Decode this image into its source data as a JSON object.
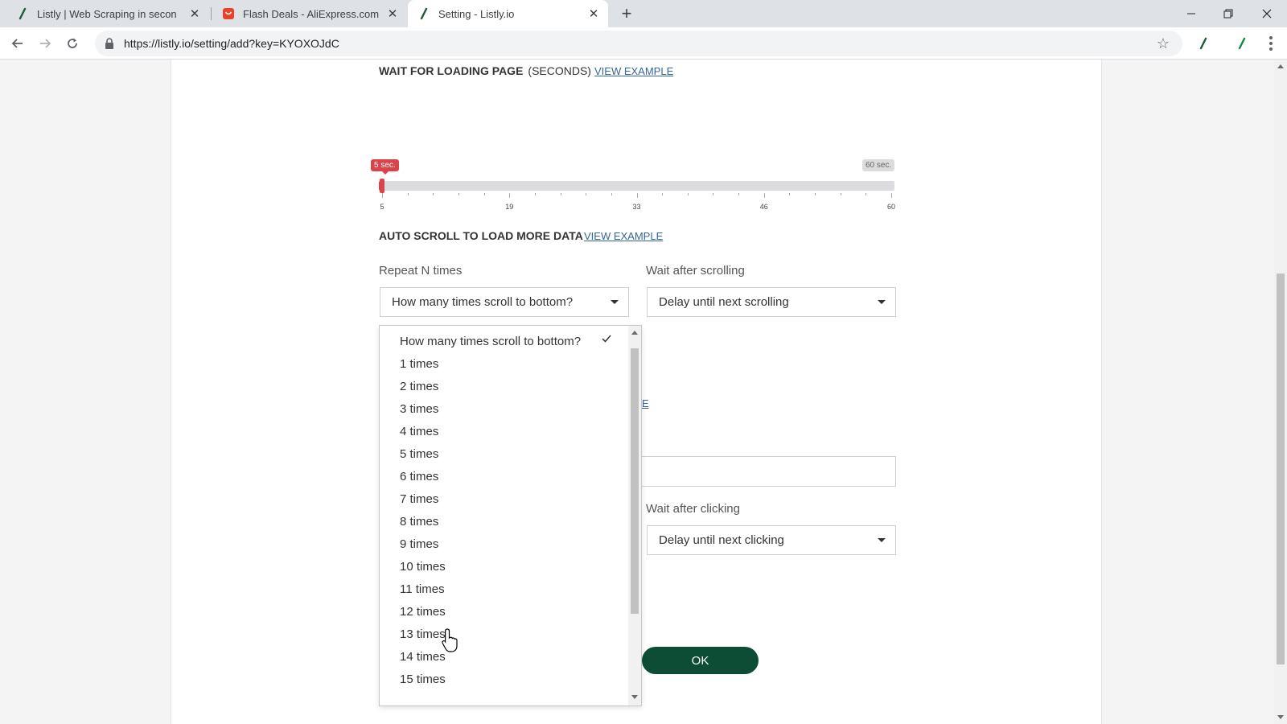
{
  "browser": {
    "tabs": [
      {
        "title": "Listly | Web Scraping in secon",
        "icon": "listly-icon",
        "active": false
      },
      {
        "title": "Flash Deals - AliExpress.com",
        "icon": "aliexpress-icon",
        "active": false
      },
      {
        "title": "Setting - Listly.io",
        "icon": "listly-icon",
        "active": true
      }
    ],
    "url": "https://listly.io/setting/add?key=KYOXOJdC"
  },
  "wait_loading": {
    "title": "WAIT FOR LOADING PAGE",
    "unit": "(SECONDS)",
    "example_link": "VIEW EXAMPLE",
    "slider": {
      "min_badge": "5 sec.",
      "max_badge": "60 sec.",
      "min": 5,
      "max": 60,
      "value": 5,
      "tick_labels": [
        "5",
        "19",
        "33",
        "46",
        "60"
      ]
    }
  },
  "auto_scroll": {
    "title": "AUTO SCROLL TO LOAD MORE DATA",
    "example_link": "VIEW EXAMPLE",
    "repeat_label": "Repeat N times",
    "repeat_value": "How many times scroll to bottom?",
    "wait_label": "Wait after scrolling",
    "wait_value": "Delay until next scrolling"
  },
  "auto_click": {
    "link_fragment": "E",
    "wait_label": "Wait after clicking",
    "wait_value": "Delay until next clicking"
  },
  "ok_button": "OK",
  "dropdown": {
    "options": [
      "How many times scroll to bottom?",
      "1 times",
      "2 times",
      "3 times",
      "4 times",
      "5 times",
      "6 times",
      "7 times",
      "8 times",
      "9 times",
      "10 times",
      "11 times",
      "12 times",
      "13 times",
      "14 times",
      "15 times"
    ],
    "selected_index": 0
  },
  "colors": {
    "accent_red": "#d9434a",
    "ok_green": "#0d4d36",
    "link_blue": "#336699"
  }
}
